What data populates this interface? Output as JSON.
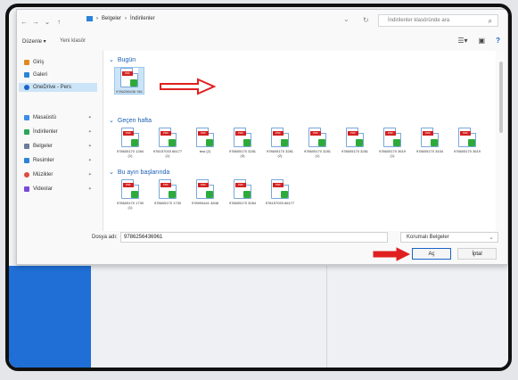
{
  "window": {
    "breadcrumb": [
      "Belgeler",
      "İndirilenler"
    ],
    "search_placeholder": "İndirilenler klasöründe ara"
  },
  "toolbar": {
    "organize_label": "Düzenle ▾",
    "new_folder_label": "Yeni klasör"
  },
  "sidebar": {
    "items": [
      {
        "label": "Giriş",
        "icon": "home-icon",
        "color": "#e08a1e"
      },
      {
        "label": "Galeri",
        "icon": "gallery-icon",
        "color": "#2b84d8"
      },
      {
        "label": "OneDrive - Pers",
        "icon": "onedrive-icon",
        "color": "#1a64c8"
      },
      {
        "label": "Masaüstü",
        "icon": "desktop-icon",
        "color": "#3b8ee8"
      },
      {
        "label": "İndirilenler",
        "icon": "download-icon",
        "color": "#2aa65b"
      },
      {
        "label": "Belgeler",
        "icon": "documents-icon",
        "color": "#6b7b9a"
      },
      {
        "label": "Resimler",
        "icon": "pictures-icon",
        "color": "#2b84d8"
      },
      {
        "label": "Müzikler",
        "icon": "music-icon",
        "color": "#e24a3b"
      },
      {
        "label": "Videolar",
        "icon": "videos-icon",
        "color": "#7a4bd8"
      }
    ]
  },
  "groups": {
    "today": {
      "label": "Bugün",
      "files": [
        "9786256436 961"
      ]
    },
    "last_week": {
      "label": "Geçen hafta",
      "files": [
        "978605170 1284 (1)",
        "978157033 66177 (1)",
        "test (2)",
        "978605170 3281 (3)",
        "978605170 3281 (2)",
        "978605170 3281 (1)",
        "978605170 3281",
        "978605170 3619(1)",
        "978605170 3434",
        "978605170 3619"
      ]
    },
    "this_month": {
      "label": "Bu ayın başlarında",
      "files": [
        "978605170 1730 (1)",
        "978605170 1730",
        "978994441 4848",
        "978605170 3284",
        "978157033 66177"
      ]
    }
  },
  "footer": {
    "filename_label": "Dosya adı:",
    "filename_value": "9786256436961",
    "filter_value": "Korumalı Belgeler",
    "open_label": "Aç",
    "cancel_label": "İptal"
  },
  "colors": {
    "accent": "#1a64c8",
    "arrow": "#e02020"
  }
}
